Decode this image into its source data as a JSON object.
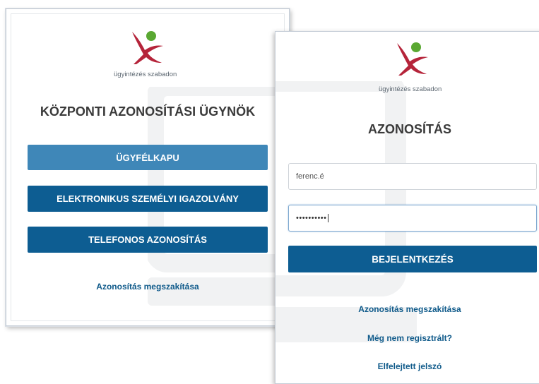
{
  "left_panel": {
    "tagline": "ügyintézés szabadon",
    "title": "KÖZPONTI AZONOSÍTÁSI ÜGYNÖK",
    "buttons": {
      "ugyfelkapu": "ÜGYFÉLKAPU",
      "eszig": "ELEKTRONIKUS SZEMÉLYI IGAZOLVÁNY",
      "telefonos": "TELEFONOS AZONOSÍTÁS"
    },
    "cancel_link": "Azonosítás megszakítása"
  },
  "right_panel": {
    "tagline": "ügyintézés szabadon",
    "title": "AZONOSÍTÁS",
    "username_value": "ferenc.é",
    "password_mask": "••••••••••",
    "login_button": "BEJELENTKEZÉS",
    "links": {
      "cancel": "Azonosítás megszakítása",
      "register": "Még nem regisztrált?",
      "forgot": "Elfelejtett jelszó"
    }
  },
  "colors": {
    "button_light": "#3f87b8",
    "button_dark": "#0d5d92",
    "link": "#0f5a8a",
    "logo_red": "#b5243a",
    "logo_green": "#5aa832"
  },
  "icons": {
    "logo": "ugyintezes-logo",
    "watermark": "laptop-watermark-icon"
  }
}
